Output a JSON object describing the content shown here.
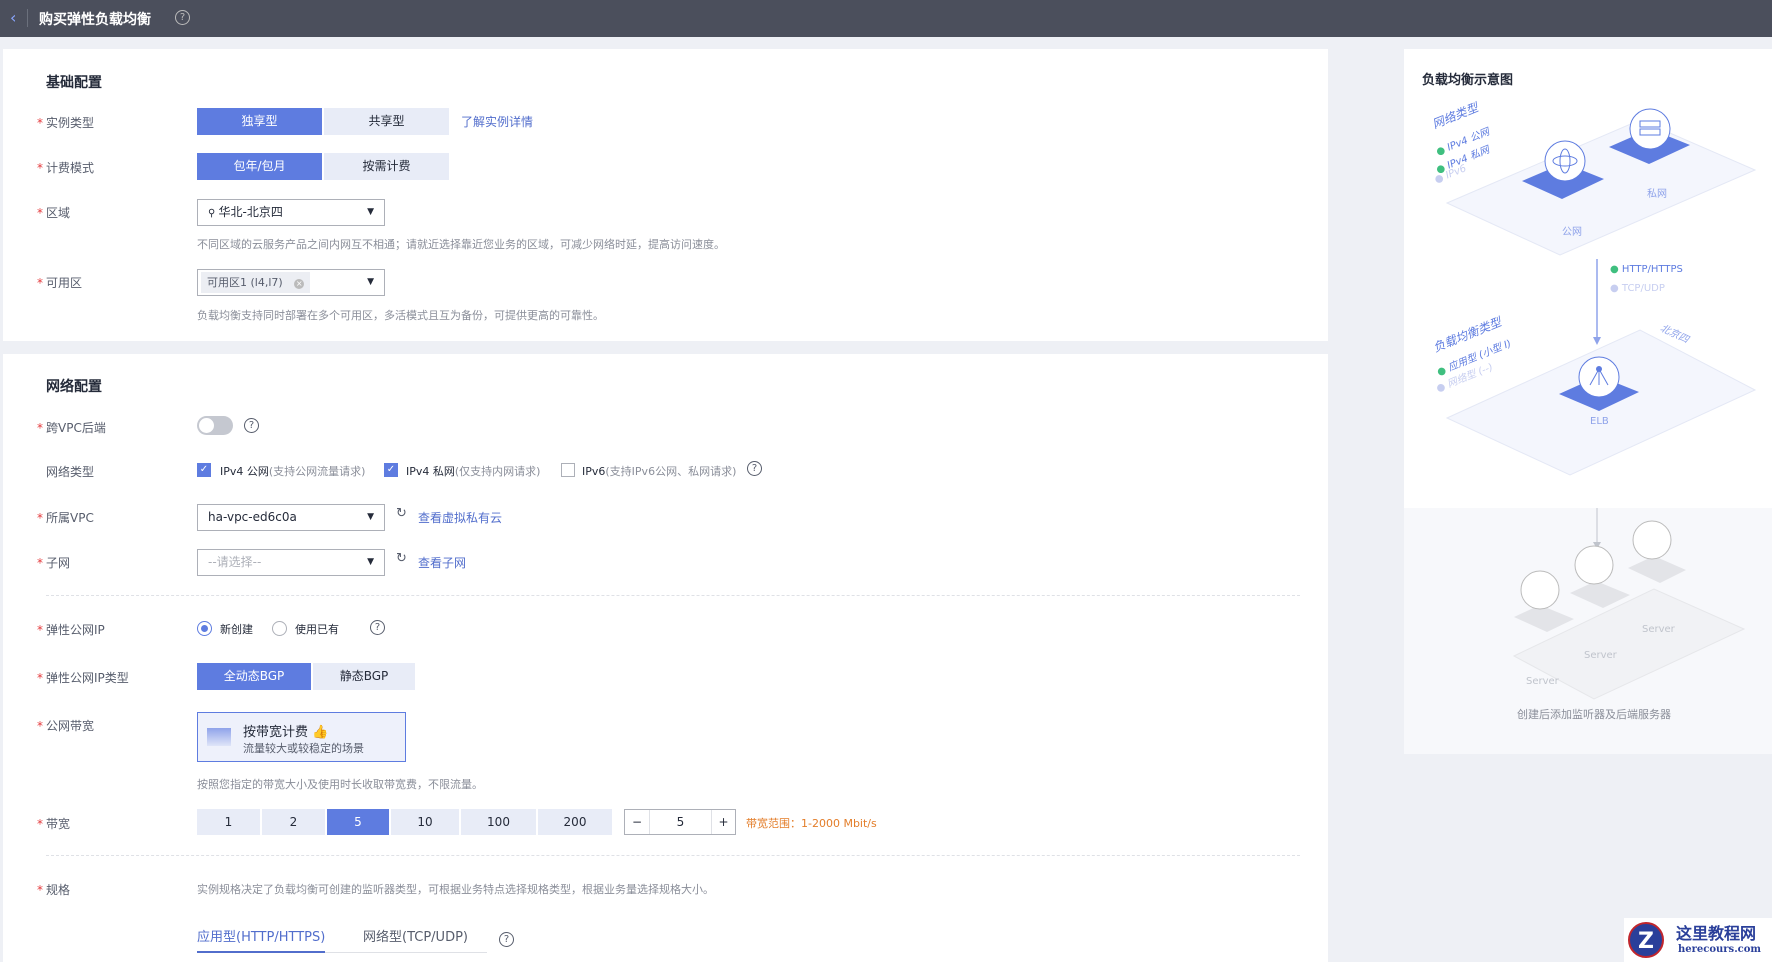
{
  "header": {
    "title": "购买弹性负载均衡",
    "back_icon": "chevron-left-icon",
    "help_icon": "question-circle-icon"
  },
  "basic": {
    "title": "基础配置",
    "instance_type": {
      "label": "实例类型",
      "options": [
        "独享型",
        "共享型"
      ],
      "selected": "独享型",
      "link": "了解实例详情"
    },
    "billing": {
      "label": "计费模式",
      "options": [
        "包年/包月",
        "按需计费"
      ],
      "selected": "包年/包月"
    },
    "region": {
      "label": "区域",
      "value": "华北-北京四",
      "hint": "不同区域的云服务产品之间内网互不相通；请就近选择靠近您业务的区域，可减少网络时延，提高访问速度。"
    },
    "az": {
      "label": "可用区",
      "tag": "可用区1 (l4,l7)",
      "hint": "负载均衡支持同时部署在多个可用区，多活模式且互为备份，可提供更高的可靠性。"
    }
  },
  "network": {
    "title": "网络配置",
    "cross_vpc": {
      "label": "跨VPC后端",
      "enabled": false
    },
    "net_type": {
      "label": "网络类型",
      "options": [
        {
          "name": "IPv4 公网",
          "desc": "(支持公网流量请求)",
          "checked": true
        },
        {
          "name": "IPv4 私网",
          "desc": "(仅支持内网请求)",
          "checked": true
        },
        {
          "name": "IPv6",
          "desc": "(支持IPv6公网、私网请求)",
          "checked": false
        }
      ]
    },
    "vpc": {
      "label": "所属VPC",
      "value": "ha-vpc-ed6c0a",
      "link": "查看虚拟私有云"
    },
    "subnet": {
      "label": "子网",
      "placeholder": "--请选择--",
      "link": "查看子网"
    },
    "eip": {
      "label": "弹性公网IP",
      "options": [
        "新创建",
        "使用已有"
      ],
      "selected": "新创建"
    },
    "eip_type": {
      "label": "弹性公网IP类型",
      "options": [
        "全动态BGP",
        "静态BGP"
      ],
      "selected": "全动态BGP"
    },
    "bw_billing": {
      "label": "公网带宽",
      "card_title": "按带宽计费",
      "card_desc": "流量较大或较稳定的场景",
      "hint": "按照您指定的带宽大小及使用时长收取带宽费，不限流量。"
    },
    "bandwidth": {
      "label": "带宽",
      "options": [
        "1",
        "2",
        "5",
        "10",
        "100",
        "200"
      ],
      "selected": "5",
      "value": "5",
      "minus": "−",
      "plus": "+",
      "range": "带宽范围：1-2000 Mbit/s"
    },
    "spec": {
      "label": "规格",
      "hint": "实例规格决定了负载均衡可创建的监听器类型，可根据业务特点选择规格类型，根据业务量选择规格大小。",
      "tabs": [
        "应用型(HTTP/HTTPS)",
        "网络型(TCP/UDP)"
      ],
      "active_tab": "应用型(HTTP/HTTPS)"
    }
  },
  "diagram": {
    "title": "负载均衡示意图",
    "net_type_title": "网络类型",
    "net_items": [
      "IPv4 公网",
      "IPv4 私网",
      "IPv6"
    ],
    "public": "公网",
    "private": "私网",
    "protocols": [
      "HTTP/HTTPS",
      "TCP/UDP"
    ],
    "lb_type_title": "负载均衡类型",
    "lb_items": [
      "应用型 (小型 I)",
      "网络型 (--)"
    ],
    "region": "北京四",
    "elb": "ELB",
    "servers": [
      "Server",
      "Server",
      "Server"
    ],
    "footer": "创建后添加监听器及后端服务器",
    "colors": {
      "accent": "#5e7ce0",
      "ok": "#3fbf7f"
    }
  },
  "watermark": {
    "cn": "这里教程网",
    "en": "herecours.com"
  }
}
